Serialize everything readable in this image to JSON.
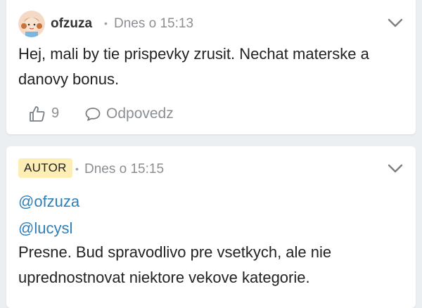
{
  "posts": [
    {
      "author": "ofzuza",
      "separator": "•",
      "time": "Dnes o 15:13",
      "text": "Hej, mali by tie prispevky zrusit. Nechat materske a danovy bonus.",
      "likes": "9",
      "reply_label": "Odpovedz",
      "avatar_icon": "girl-avatar-icon",
      "menu_icon": "chevron-down-icon"
    },
    {
      "badge": "AUTOR",
      "separator": "•",
      "time": "Dnes o 15:15",
      "mentions": [
        "@ofzuza",
        "@lucysl"
      ],
      "text": "Presne. Bud spravodlivo pre vsetkych, ale nie uprednostnovat niektore vekove kategorie.",
      "menu_icon": "chevron-down-icon"
    }
  ],
  "colors": {
    "background": "#eceff1",
    "card": "#ffffff",
    "mention": "#2e7fb8",
    "muted": "#8a8f94",
    "badge_bg": "#fdeeb5"
  }
}
